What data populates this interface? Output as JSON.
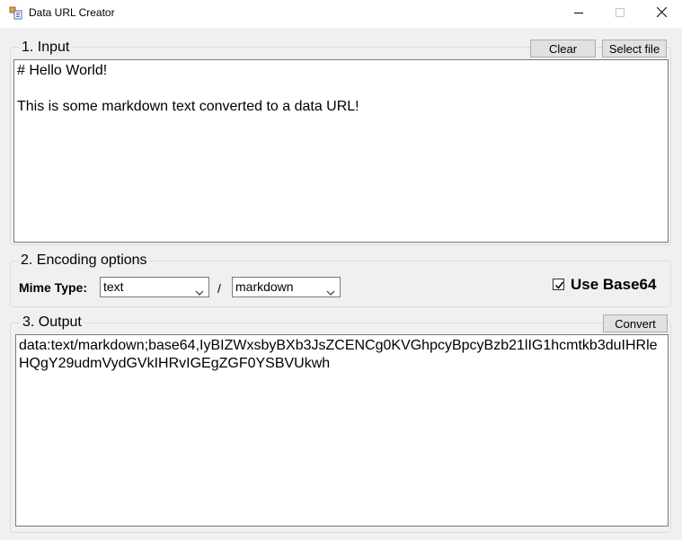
{
  "window": {
    "title": "Data URL Creator",
    "icons": {
      "app": "app-icon",
      "minimize": "minimize-icon",
      "maximize": "maximize-icon",
      "close": "close-icon"
    }
  },
  "input": {
    "group_title": "1. Input",
    "clear_label": "Clear",
    "select_file_label": "Select file",
    "text": "# Hello World!\n\nThis is some markdown text converted to a data URL!"
  },
  "encoding": {
    "group_title": "2. Encoding options",
    "mime_type_label": "Mime Type:",
    "mime_main": "text",
    "separator": "/",
    "mime_sub": "markdown",
    "use_base64_label": "Use Base64",
    "use_base64_checked": true
  },
  "output": {
    "group_title": "3. Output",
    "convert_label": "Convert",
    "text": "data:text/markdown;base64,IyBIZWxsbyBXb3JsZCENCg0KVGhpcyBpcyBzb21lIG1hcmtkb3duIHRleHQgY29udmVydGVkIHRvIGEgZGF0YSBVUkwh"
  }
}
